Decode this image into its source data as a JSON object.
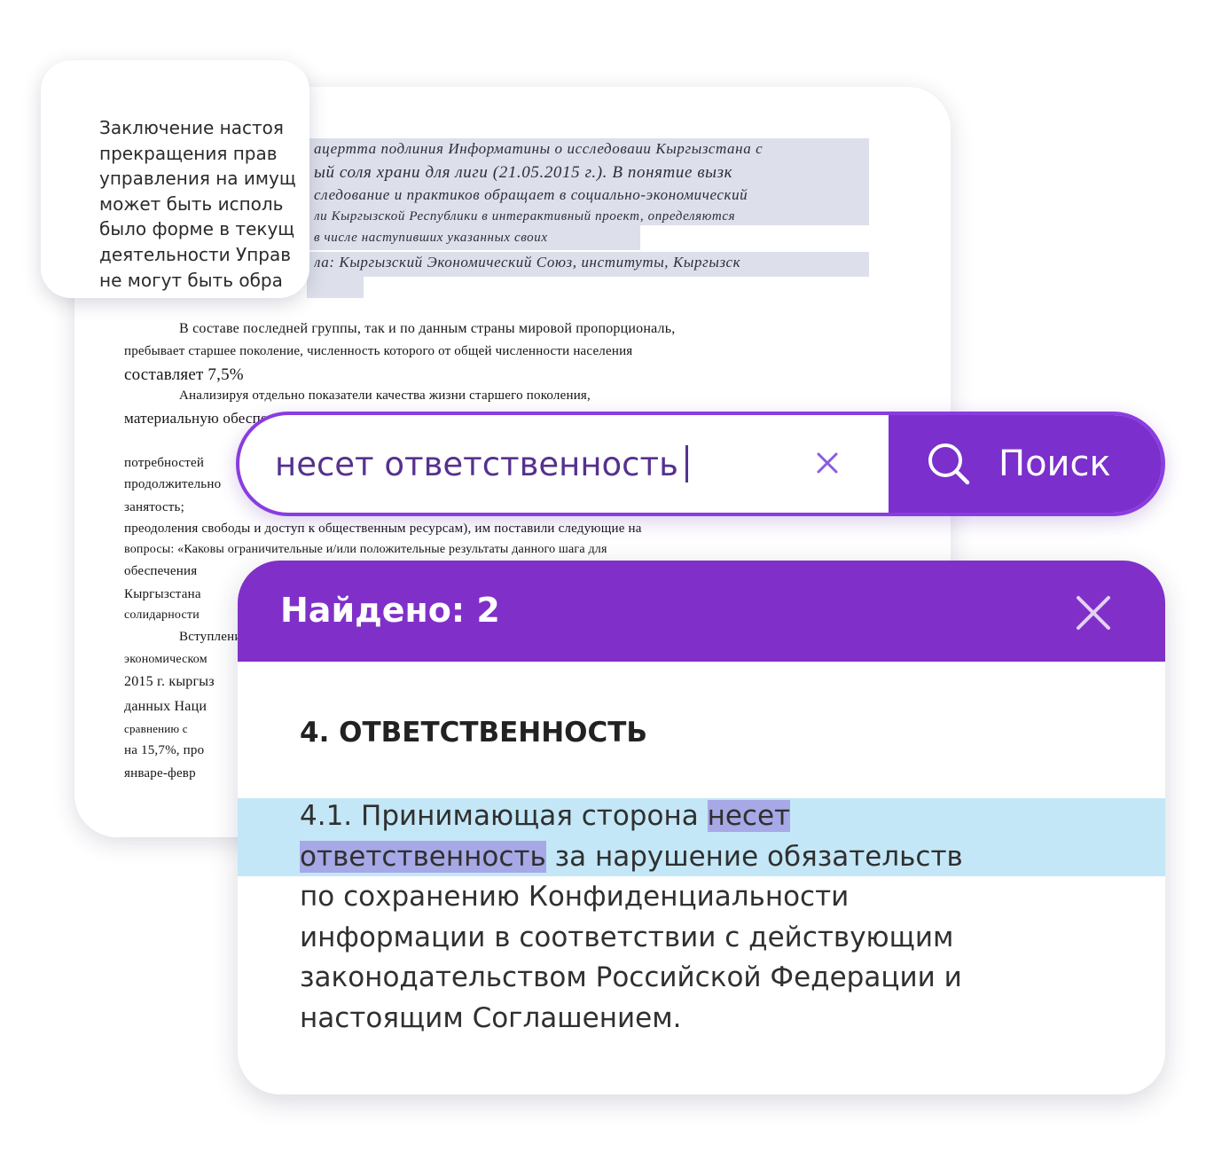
{
  "ocr_preview": {
    "lines": [
      "Заключение настоя",
      "прекращения прав",
      "управления на имущ",
      "может быть исполь",
      "было форме в текущ",
      "деятельности Управ",
      "не могут быть обра"
    ]
  },
  "scanned_document": {
    "highlighted_lines": [
      "ацертта подлиния Информатины о исследоваии Кыргызстана  с",
      "ый соля храни для лиги (21.05.2015 г.). В понятие вызк",
      "следование и практиков обращает  в  социально-экономический",
      "ли Кыргызской Республики в интерактивный проект, определяются",
      "в числе наступивших указанных своих",
      "ла:  Кыргызский  Экономический  Союз,  институты,  Кыргызск"
    ],
    "body_lines": [
      "В составе последней  группы,  так и по данным страны мировой пропорциональ,",
      "пребывает  старшее  поколение,  численность  которого  от  общей  численности  населения",
      "составляет 7,5%",
      "Анализируя   отдельно   показатели   качества   жизни   старшего   поколения,",
      "материальную обеспеч",
      "потребностей",
      "продолжительно",
      "занятость;",
      "преодоления свободы и доступ к общественным ресурсам), им поставили следующие на",
      "вопросы: «Каковы ограничительные и/или положительные результаты данного шага для",
      "обеспечения",
      "Кыргызстана",
      "солидарности",
      "Вступление",
      "экономическом",
      "2015 г. кыргыз",
      "данных  Наци",
      "сравнению с",
      "на 15,7%, про",
      "январе-февр"
    ]
  },
  "search": {
    "query": "несет ответственность",
    "button_label": "Поиск"
  },
  "results": {
    "count_label": "Найдено: 2",
    "section_heading": "4. ОТВЕТСТВЕННОСТЬ",
    "paragraph": {
      "line1_before": "4.1. Принимающая сторона ",
      "line1_hit": "несет",
      "line2_hit": "ответственность",
      "line2_after": " за нарушение обязательств",
      "line3": "по сохранению Конфиденциальности",
      "line4": "информации в соответствии с действующим",
      "line5": "законодательством Российской Федерации и",
      "line6": "настоящим Соглашением."
    }
  },
  "colors": {
    "accent_purple": "#8030c8",
    "match_band": "#c3e7f7",
    "match_highlight": "#a7a8e6"
  }
}
